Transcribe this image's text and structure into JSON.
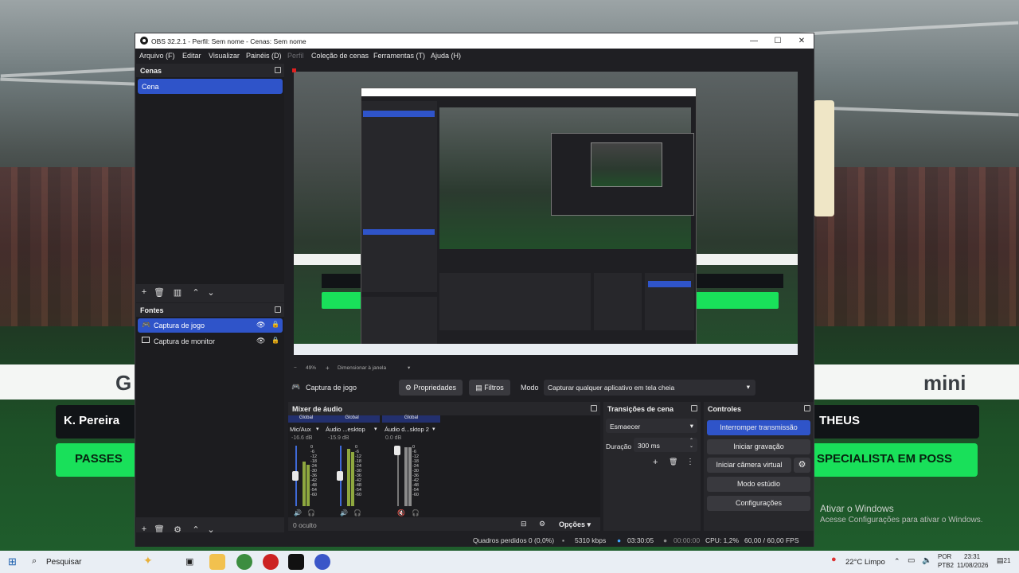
{
  "window": {
    "title": "OBS 32.2.1 - Perfil: Sem nome - Cenas: Sem nome",
    "minimize": "—",
    "maximize": "☐",
    "close": "✕"
  },
  "menu": [
    "Arquivo (F)",
    "Editar",
    "Visualizar",
    "Painéis (D)",
    "Perfil",
    "Coleção de cenas",
    "Ferramentas (T)",
    "Ajuda (H)"
  ],
  "scenes": {
    "title": "Cenas",
    "items": [
      "Cena"
    ]
  },
  "sources": {
    "title": "Fontes",
    "items": [
      {
        "label": "Captura de jogo",
        "selected": true,
        "icon": "gamepad-icon"
      },
      {
        "label": "Captura de monitor",
        "selected": false,
        "icon": "monitor-icon"
      }
    ]
  },
  "zoom": {
    "minus": "−",
    "value": "49%",
    "plus": "+",
    "mode": "Dimensionar à janela"
  },
  "source_toolbar": {
    "name": "Captura de jogo",
    "properties": "Propriedades",
    "filters": "Filtros",
    "mode_label": "Modo",
    "mode_value": "Capturar qualquer aplicativo em tela cheia"
  },
  "mixer": {
    "title": "Mixer de áudio",
    "channels": [
      {
        "global": "Global",
        "name": "Mic/Aux",
        "db": "-16.6 dB",
        "fader_level": 0.54
      },
      {
        "global": "Global",
        "name": "Áudio ...esktop",
        "db": "-15.9 dB",
        "fader_level": 0.55
      },
      {
        "global": "Global",
        "name": "Áudio d...sktop 2",
        "db": "0.0 dB",
        "fader_level": 1.0
      }
    ],
    "scale": [
      "0",
      "-6",
      "-12",
      "-18",
      "-24",
      "-30",
      "-36",
      "-42",
      "-48",
      "-54",
      "-60"
    ],
    "hidden": "0 oculto",
    "options": "Opções"
  },
  "transitions": {
    "title": "Transições de cena",
    "type": "Esmaecer",
    "duration_label": "Duração",
    "duration_value": "300 ms"
  },
  "controls": {
    "title": "Controles",
    "stop_stream": "Interromper transmissão",
    "start_recording": "Iniciar gravação",
    "start_virtual_cam": "Iniciar câmera virtual",
    "studio_mode": "Modo estúdio",
    "settings": "Configurações"
  },
  "status": {
    "dropped_frames": "Quadros perdidos 0 (0,0%)",
    "bitrate": "5310 kbps",
    "stream_time": "03:30:05",
    "rec_time": "00:00:00",
    "cpu": "CPU: 1,2%",
    "fps": "60,00 / 60,00 FPS"
  },
  "wallpaper": {
    "banner_left": "G",
    "banner_right": "mini",
    "card_left": "K. Pereira",
    "card_right": "THEUS",
    "btn_left": "PASSES",
    "btn_right": "SPECIALISTA EM POSS",
    "wm_title": "Ativar o Windows",
    "wm_sub": "Acesse Configurações para ativar o Windows."
  },
  "taskbar": {
    "search": "Pesquisar",
    "weather": "22°C Limpo",
    "lang1": "POR",
    "lang2": "PTB2",
    "time": "23:31",
    "date": "11/08/2026",
    "notif": "21"
  },
  "colors": {
    "accent": "#2f54c9",
    "panel": "#27272b",
    "background": "#1f1f23",
    "meter_green": "#8ea83f"
  }
}
